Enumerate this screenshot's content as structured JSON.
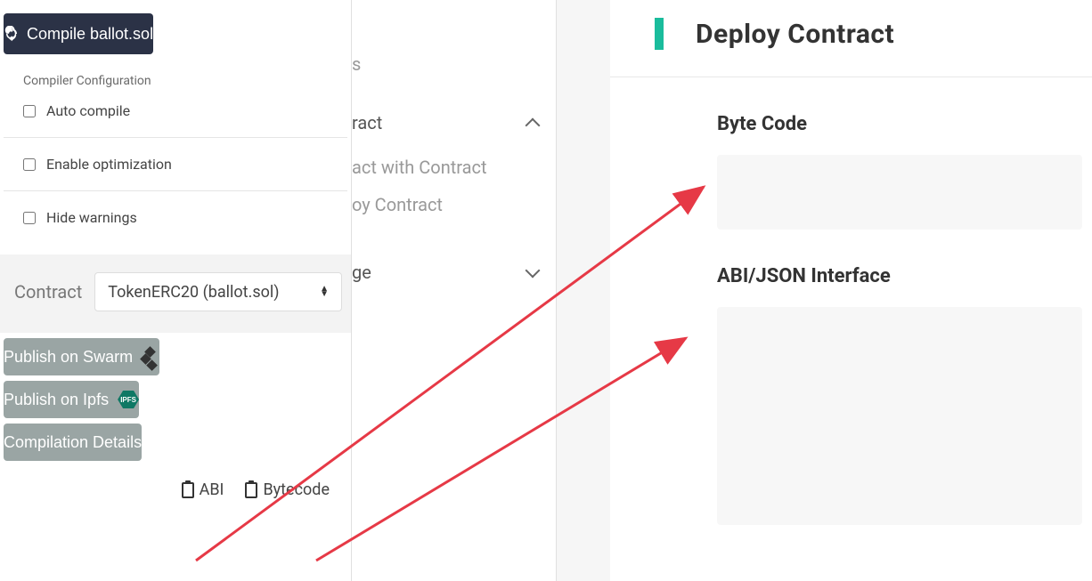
{
  "compile_button": "Compile ballot.sol",
  "config_label": "Compiler Configuration",
  "checkbox_auto_compile": "Auto compile",
  "checkbox_enable_optimization": "Enable optimization",
  "checkbox_hide_warnings": "Hide warnings",
  "contract_label": "Contract",
  "contract_selected": "TokenERC20 (ballot.sol)",
  "publish_swarm": "Publish on Swarm",
  "publish_ipfs": "Publish on Ipfs",
  "compilation_details": "Compilation Details",
  "abi_link": "ABI",
  "bytecode_link": "Bytecode",
  "middle": {
    "top_text": "s",
    "section1": "ract",
    "item1": "act with Contract",
    "item2": "oy Contract",
    "section2": "ge"
  },
  "right": {
    "header": "Deploy Contract",
    "bytecode_title": "Byte Code",
    "abi_title": "ABI/JSON Interface"
  },
  "ipfs_label": "IPFS"
}
